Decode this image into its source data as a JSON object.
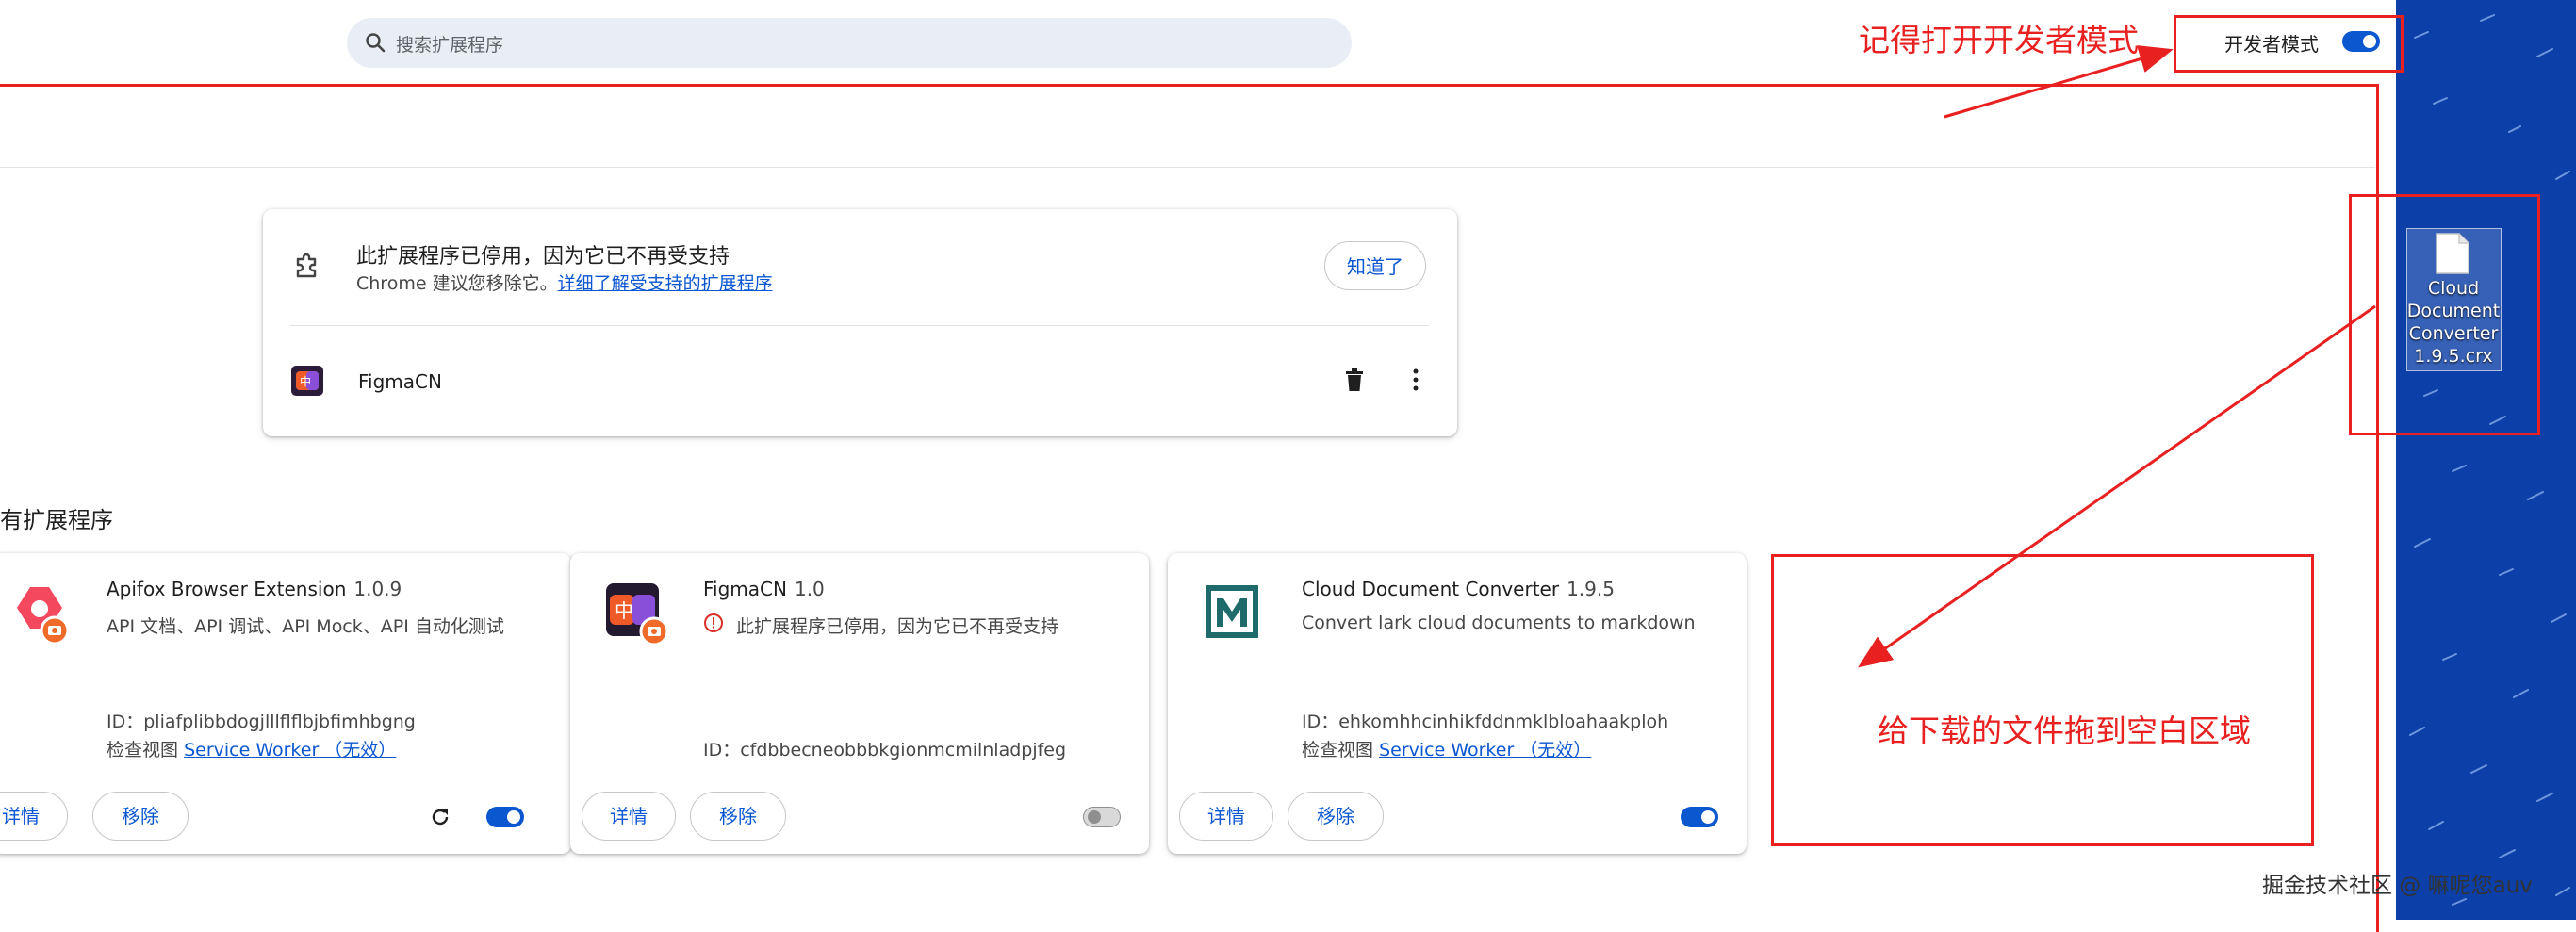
{
  "search": {
    "placeholder": "搜索扩展程序"
  },
  "developer_mode": {
    "label": "开发者模式",
    "enabled": true
  },
  "warning": {
    "title": "此扩展程序已停用，因为它已不再受支持",
    "subtitle_prefix": "Chrome 建议您移除它。",
    "subtitle_link": "详细了解受支持的扩展程序",
    "got_it_label": "知道了",
    "extension_name": "FigmaCN"
  },
  "section_title": "有扩展程序",
  "extensions": [
    {
      "name": "Apifox Browser Extension",
      "version": "1.0.9",
      "description": "API 文档、API 调试、API Mock、API 自动化测试",
      "id": "ID：pliafplibbdogjlllflflbjbfimhbgng",
      "inspect_prefix": "检查视图",
      "inspect_link": "Service Worker （无效）",
      "details_label": "详情",
      "remove_label": "移除",
      "enabled": true
    },
    {
      "name": "FigmaCN",
      "version": "1.0",
      "description": "此扩展程序已停用，因为它已不再受支持",
      "id": "ID：cfdbbecneobbbkgionmcmilnladpjfeg",
      "details_label": "详情",
      "remove_label": "移除",
      "enabled": false
    },
    {
      "name": "Cloud Document Converter",
      "version": "1.9.5",
      "description": "Convert lark cloud documents to markdown",
      "id": "ID：ehkomhhcinhikfddnmklbloahaakploh",
      "inspect_prefix": "检查视图",
      "inspect_link": "Service Worker （无效）",
      "details_label": "详情",
      "remove_label": "移除",
      "enabled": true
    }
  ],
  "annotations": {
    "dev_mode_hint": "记得打开开发者模式",
    "drop_hint": "给下载的文件拖到空白区域"
  },
  "desktop_file": {
    "label": "Cloud Document Converter 1.9.5.crx"
  },
  "watermark": "掘金技术社区 @ 嘛呢您auv",
  "colors": {
    "accent": "#0b57d0",
    "annotation": "#e8201f",
    "desktop": "#0c3fa8"
  }
}
